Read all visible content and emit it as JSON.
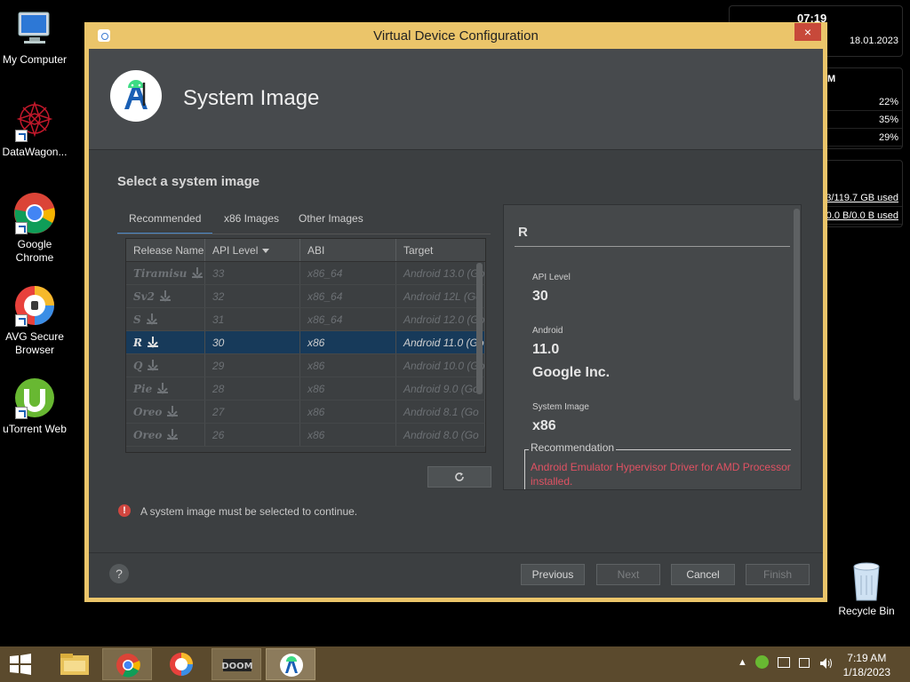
{
  "desktop": {
    "icons": [
      {
        "label": "My Computer"
      },
      {
        "label": "DataWagon..."
      },
      {
        "label": "Google Chrome"
      },
      {
        "label": "AVG Secure Browser"
      },
      {
        "label": "uTorrent Web"
      }
    ],
    "recycle_bin": "Recycle Bin"
  },
  "gadget": {
    "time": "07:19",
    "date": "18.01.2023",
    "mem_header": "M",
    "cpu_rows": [
      "22%",
      "35%",
      "29%"
    ],
    "disk_rows": [
      "3/119.7 GB used",
      "0.0 B/0.0 B used"
    ]
  },
  "dialog": {
    "title": "Virtual Device Configuration",
    "close": "×",
    "header_title": "System Image",
    "section_title": "Select a system image",
    "tabs": [
      "Recommended",
      "x86 Images",
      "Other Images"
    ],
    "table": {
      "headers": [
        "Release Name",
        "API Level",
        "ABI",
        "Target"
      ],
      "rows": [
        {
          "name": "Tiramisu",
          "api": "33",
          "abi": "x86_64",
          "target": "Android 13.0 (Go"
        },
        {
          "name": "Sv2",
          "api": "32",
          "abi": "x86_64",
          "target": "Android 12L (Go"
        },
        {
          "name": "S",
          "api": "31",
          "abi": "x86_64",
          "target": "Android 12.0 (Go"
        },
        {
          "name": "R",
          "api": "30",
          "abi": "x86",
          "target": "Android 11.0 (Go"
        },
        {
          "name": "Q",
          "api": "29",
          "abi": "x86",
          "target": "Android 10.0 (Go"
        },
        {
          "name": "Pie",
          "api": "28",
          "abi": "x86",
          "target": "Android 9.0 (Go"
        },
        {
          "name": "Oreo",
          "api": "27",
          "abi": "x86",
          "target": "Android 8.1 (Go"
        },
        {
          "name": "Oreo",
          "api": "26",
          "abi": "x86",
          "target": "Android 8.0 (Go"
        }
      ],
      "selected_index": 3
    },
    "error": "A system image must be selected to continue.",
    "details": {
      "name": "R",
      "api_label": "API Level",
      "api_value": "30",
      "android_label": "Android",
      "android_value": "11.0",
      "vendor": "Google Inc.",
      "system_image_label": "System Image",
      "system_image_value": "x86",
      "recommendation_label": "Recommendation",
      "recommendation_text": "Android Emulator Hypervisor Driver for AMD Processor installed."
    },
    "buttons": {
      "help": "?",
      "previous": "Previous",
      "next": "Next",
      "cancel": "Cancel",
      "finish": "Finish"
    }
  },
  "taskbar": {
    "time": "7:19 AM",
    "date": "1/18/2023"
  },
  "colors": {
    "dialog_border": "#ebc56a",
    "dialog_bg": "#3c3f41",
    "selection": "#173a5a",
    "error": "#d0463f",
    "recommendation_text": "#e05263",
    "taskbar": "#5b4a2d"
  }
}
